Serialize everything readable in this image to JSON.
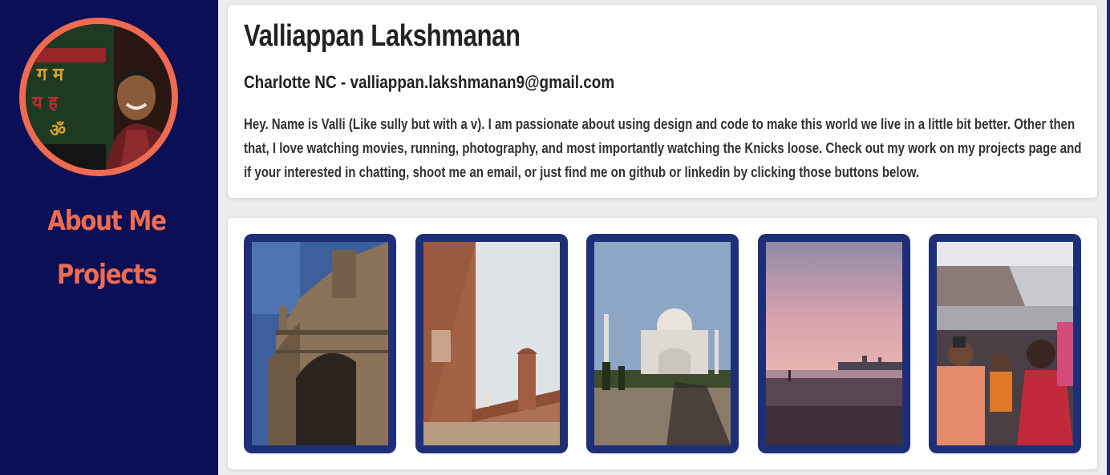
{
  "sidebar": {
    "avatar_alt": "Profile photo",
    "nav": [
      {
        "label": "About Me"
      },
      {
        "label": "Projects"
      }
    ]
  },
  "about": {
    "name": "Valliappan Lakshmanan",
    "contact": "Charlotte NC - valliappan.lakshmanan9@gmail.com",
    "bio": "Hey. Name is Valli (Like sully but with a v). I am passionate about using design and code to make this world we live in a little bit better. Other then that, I love watching movies, running, photography, and most importantly watching the Knicks loose. Check out my work on my projects page and if your interested in chatting, shoot me an email, or just find me on github or linkedin by clicking those buttons below."
  },
  "colors": {
    "sidebar_bg": "#0b0f55",
    "accent": "#ee6b51",
    "photo_frame": "#1e2f78"
  },
  "gallery": {
    "photos": [
      {
        "subject": "arch-monument-photo"
      },
      {
        "subject": "red-fort-wall-photo"
      },
      {
        "subject": "taj-mahal-photo"
      },
      {
        "subject": "sunset-beach-photo"
      },
      {
        "subject": "crowd-ceremony-photo"
      }
    ]
  }
}
